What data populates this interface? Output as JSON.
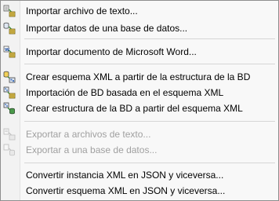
{
  "menu": {
    "items": [
      {
        "label": "Importar archivo de texto...",
        "icon": "import-text-icon",
        "enabled": true
      },
      {
        "label": "Importar datos de una base de datos...",
        "icon": "import-database-icon",
        "enabled": true
      },
      {
        "label": "Importar documento de Microsoft Word...",
        "icon": "import-word-icon",
        "enabled": true
      },
      {
        "label": "Crear esquema XML a partir de la estructura de la BD",
        "icon": "schema-from-db-icon",
        "enabled": true
      },
      {
        "label": "Importación de BD basada en el esquema XML",
        "icon": "db-import-schema-icon",
        "enabled": true
      },
      {
        "label": "Crear estructura de la BD a partir del esquema XML",
        "icon": "db-from-schema-icon",
        "enabled": true
      },
      {
        "label": "Exportar a archivos de texto...",
        "icon": "export-text-icon",
        "enabled": false
      },
      {
        "label": "Exportar a una base de datos...",
        "icon": "export-database-icon",
        "enabled": false
      },
      {
        "label": "Convertir instancia XML en JSON y viceversa...",
        "icon": "",
        "enabled": true
      },
      {
        "label": "Convertir esquema XML en JSON y viceversa...",
        "icon": "",
        "enabled": true
      }
    ]
  }
}
